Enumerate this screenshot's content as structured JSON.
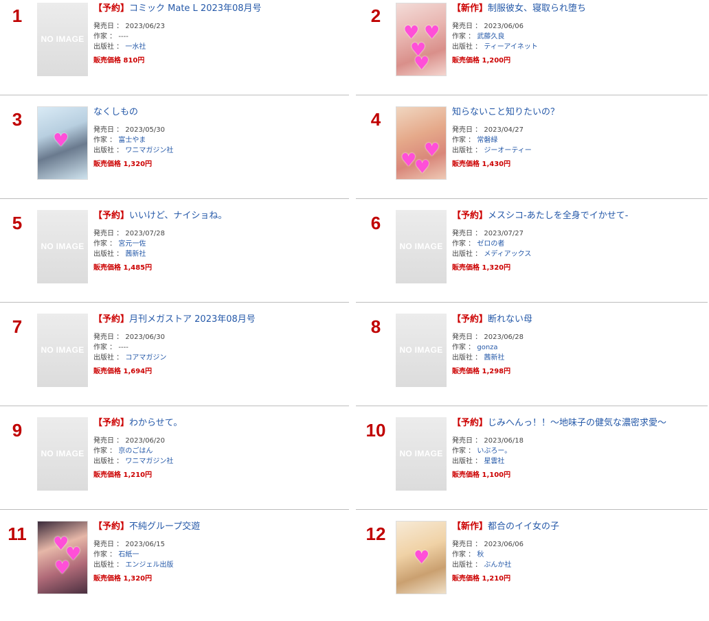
{
  "labels": {
    "release_label": "発売日 ：",
    "author_label": "作家 ：",
    "publisher_label": "出版社 ：",
    "price_label": "販売価格",
    "no_image": "NO IMAGE"
  },
  "items": [
    {
      "rank": "1",
      "badge": "【予約】",
      "title": "コミック Mate L 2023年08月号",
      "date": "2023/06/23",
      "author": "----",
      "publisher": "一水社",
      "price": "810円",
      "cover": "none"
    },
    {
      "rank": "2",
      "badge": "【新作】",
      "title": "制服彼女、寝取られ堕ち",
      "date": "2023/06/06",
      "author": "武藤久良",
      "publisher": "ティーアイネット",
      "price": "1,200円",
      "cover": "art"
    },
    {
      "rank": "3",
      "badge": "",
      "title": "なくしもの",
      "date": "2023/05/30",
      "author": "富士やま",
      "publisher": "ワニマガジン社",
      "price": "1,320円",
      "cover": "art"
    },
    {
      "rank": "4",
      "badge": "",
      "title": "知らないこと知りたいの？",
      "date": "2023/04/27",
      "author": "常磐緑",
      "publisher": "ジーオーティー",
      "price": "1,430円",
      "cover": "art"
    },
    {
      "rank": "5",
      "badge": "【予約】",
      "title": "いいけど、ナイショね。",
      "date": "2023/07/28",
      "author": "宮元一佐",
      "publisher": "茜新社",
      "price": "1,485円",
      "cover": "none"
    },
    {
      "rank": "6",
      "badge": "【予約】",
      "title": "メスシコ-あたしを全身でイかせて-",
      "date": "2023/07/27",
      "author": "ゼロの者",
      "publisher": "メディアックス",
      "price": "1,320円",
      "cover": "none"
    },
    {
      "rank": "7",
      "badge": "【予約】",
      "title": "月刊メガストア 2023年08月号",
      "date": "2023/06/30",
      "author": "----",
      "publisher": "コアマガジン",
      "price": "1,694円",
      "cover": "none"
    },
    {
      "rank": "8",
      "badge": "【予約】",
      "title": "断れない母",
      "date": "2023/06/28",
      "author": "gonza",
      "publisher": "茜新社",
      "price": "1,298円",
      "cover": "none"
    },
    {
      "rank": "9",
      "badge": "【予約】",
      "title": "わからせて。",
      "date": "2023/06/20",
      "author": "京のごはん",
      "publisher": "ワニマガジン社",
      "price": "1,210円",
      "cover": "none"
    },
    {
      "rank": "10",
      "badge": "【予約】",
      "title": "じみへんっ！！～地味子の健気な濃密求愛～",
      "date": "2023/06/18",
      "author": "いぶろー。",
      "publisher": "星雲社",
      "price": "1,100円",
      "cover": "none"
    },
    {
      "rank": "11",
      "badge": "【予約】",
      "title": "不純グループ交遊",
      "date": "2023/06/15",
      "author": "石紙一",
      "publisher": "エンジェル出版",
      "price": "1,320円",
      "cover": "art"
    },
    {
      "rank": "12",
      "badge": "【新作】",
      "title": "都合のイイ女の子",
      "date": "2023/06/06",
      "author": "秋",
      "publisher": "ぶんか社",
      "price": "1,210円",
      "cover": "art"
    }
  ],
  "colors": {
    "rank": "#c00000",
    "link": "#2458a8",
    "price": "#cc0000",
    "divider": "#bcbcbc",
    "heart": "#ff4fd8"
  }
}
